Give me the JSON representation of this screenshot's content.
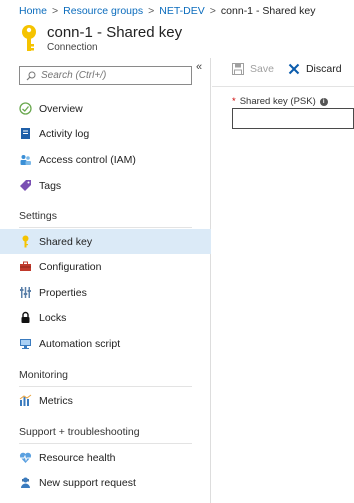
{
  "breadcrumb": [
    "Home",
    "Resource groups",
    "NET-DEV",
    "conn-1 - Shared key"
  ],
  "header": {
    "title": "conn-1 - Shared key",
    "subtitle": "Connection"
  },
  "search": {
    "placeholder": "Search (Ctrl+/)",
    "value": ""
  },
  "collapse_glyph": "«",
  "nav": {
    "overview": "Overview",
    "activity_log": "Activity log",
    "access_control": "Access control (IAM)",
    "tags": "Tags",
    "settings_header": "Settings",
    "shared_key": "Shared key",
    "configuration": "Configuration",
    "properties": "Properties",
    "locks": "Locks",
    "automation_script": "Automation script",
    "monitoring_header": "Monitoring",
    "metrics": "Metrics",
    "support_header": "Support + troubleshooting",
    "resource_health": "Resource health",
    "new_support_request": "New support request"
  },
  "toolbar": {
    "save_label": "Save",
    "discard_label": "Discard"
  },
  "form": {
    "psk_label": "Shared key (PSK)",
    "required_marker": "*",
    "psk_value": "",
    "info_glyph": "i"
  },
  "colors": {
    "accent": "#0b6cbd",
    "active_bg": "#dbeaf7",
    "key_yellow": "#f5c300",
    "discard_blue": "#0b5cad"
  }
}
